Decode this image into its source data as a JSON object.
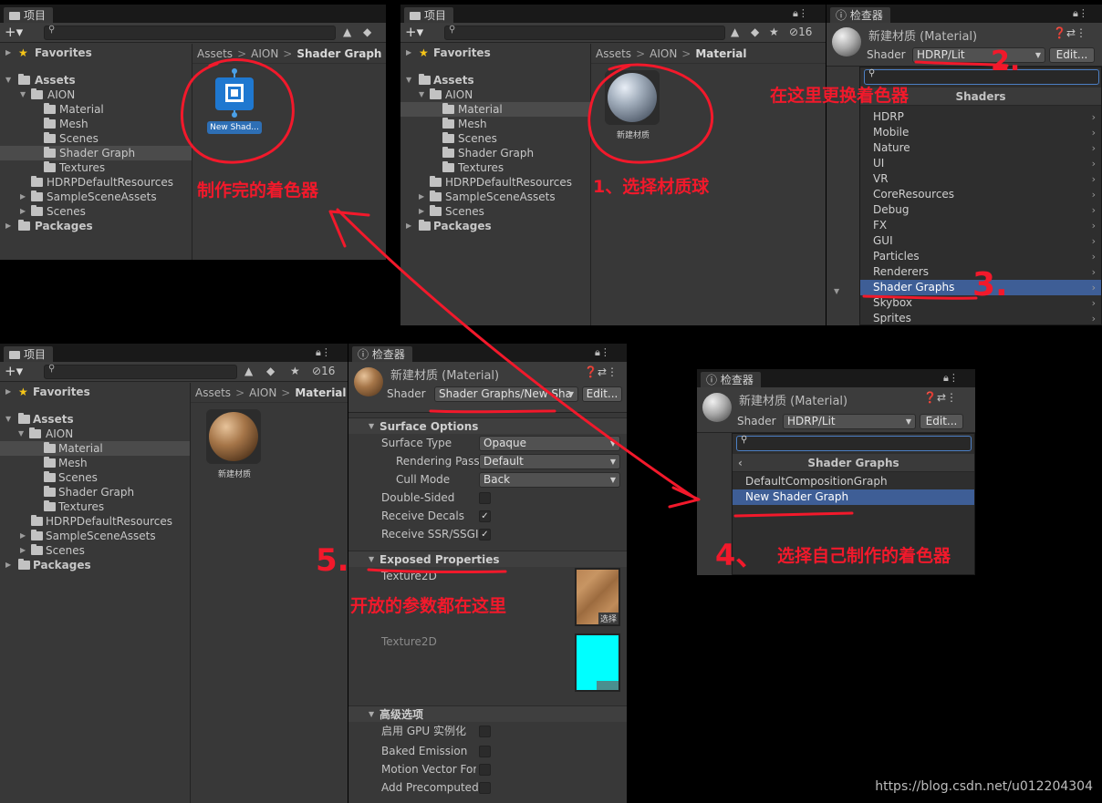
{
  "panel1": {
    "tab": "项目",
    "crumbs": [
      "Assets",
      "AION",
      "Shader Graph"
    ],
    "tree": {
      "favorites": "Favorites",
      "assets": "Assets",
      "aion": "AION",
      "material": "Material",
      "mesh": "Mesh",
      "scenes": "Scenes",
      "shader_graph": "Shader Graph",
      "textures": "Textures",
      "hdrp": "HDRPDefaultResources",
      "sample": "SampleSceneAssets",
      "scenes_root": "Scenes",
      "packages": "Packages"
    },
    "asset_label": "New Shad..."
  },
  "panel2": {
    "tab": "项目",
    "crumbs": [
      "Assets",
      "AION",
      "Material"
    ],
    "hidden_count": "16",
    "asset_label": "新建材质"
  },
  "inspector1": {
    "tab": "检查器",
    "title": "新建材质 (Material)",
    "shader_label": "Shader",
    "shader_value": "HDRP/Lit",
    "edit": "Edit...",
    "popup_header": "Shaders",
    "items": [
      "HDRP",
      "Mobile",
      "Nature",
      "UI",
      "VR",
      "CoreResources",
      "Debug",
      "FX",
      "GUI",
      "Particles",
      "Renderers",
      "Shader Graphs",
      "Skybox",
      "Sprites"
    ],
    "selected_item": "Shader Graphs"
  },
  "panel3": {
    "tab": "项目",
    "crumbs": [
      "Assets",
      "AION",
      "Material"
    ],
    "hidden_count": "16",
    "asset_label": "新建材质"
  },
  "inspector2": {
    "tab": "检查器",
    "title": "新建材质 (Material)",
    "shader_label": "Shader",
    "shader_value": "Shader Graphs/New Sha",
    "edit": "Edit...",
    "surface_options": "Surface Options",
    "surface_type_label": "Surface Type",
    "surface_type_value": "Opaque",
    "rendering_pass_label": "Rendering Pass",
    "rendering_pass_value": "Default",
    "cull_mode_label": "Cull Mode",
    "cull_mode_value": "Back",
    "double_sided": "Double-Sided",
    "receive_decals": "Receive Decals",
    "receive_ssr": "Receive SSR/SSGI",
    "exposed": "Exposed Properties",
    "tex1": "Texture2D",
    "tex1_select": "选择",
    "tex2": "Texture2D",
    "advanced": "高级选项",
    "gpu_instancing": "启用 GPU 实例化",
    "baked_emission": "Baked Emission",
    "motion_vector": "Motion Vector For",
    "add_precomputed": "Add Precomputed"
  },
  "inspector3": {
    "tab": "检查器",
    "title": "新建材质 (Material)",
    "shader_label": "Shader",
    "shader_value": "HDRP/Lit",
    "edit": "Edit...",
    "popup_header": "Shader Graphs",
    "items": [
      "DefaultCompositionGraph",
      "New Shader Graph"
    ],
    "selected_item": "New Shader Graph"
  },
  "annotations": {
    "made": "制作完的着色器",
    "step1": "1、选择材质球",
    "step2": "在这里更换着色器",
    "step4": "选择自己制作的着色器",
    "step5": "开放的参数都在这里",
    "num2": "2.",
    "num3": "3.",
    "num4": "4、",
    "num5": "5."
  },
  "watermark": "https://blog.csdn.net/u012204304",
  "colors": {
    "annotation": "#f2192b",
    "selection": "#3e5e96",
    "cyan": "#00ffff",
    "panel": "#383838"
  }
}
